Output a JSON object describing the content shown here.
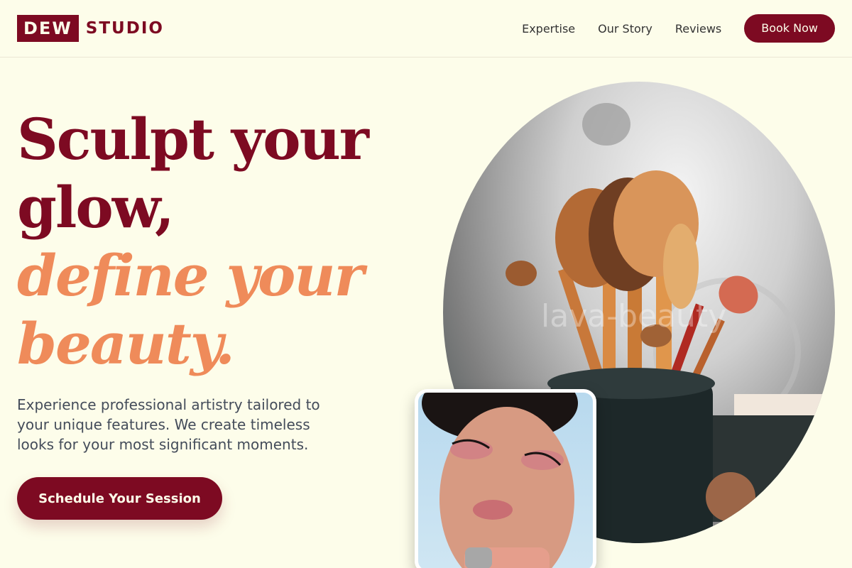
{
  "brand": {
    "box_text": "DEW",
    "word": "STUDIO"
  },
  "nav": {
    "links": [
      "Expertise",
      "Our Story",
      "Reviews"
    ],
    "book_label": "Book Now"
  },
  "hero": {
    "title_line1": "Sculpt your",
    "title_line2": "glow,",
    "title_line3": "define your",
    "title_line4": "beauty.",
    "description": "Experience professional artistry tailored to your unique features. We create timeless looks for your most significant moments.",
    "cta_label": "Schedule Your Session"
  },
  "images": {
    "brushes_watermark": "lava-beauty"
  },
  "colors": {
    "brand": "#7d0a22",
    "accent": "#ef8b5a",
    "background": "#fdfdea"
  }
}
